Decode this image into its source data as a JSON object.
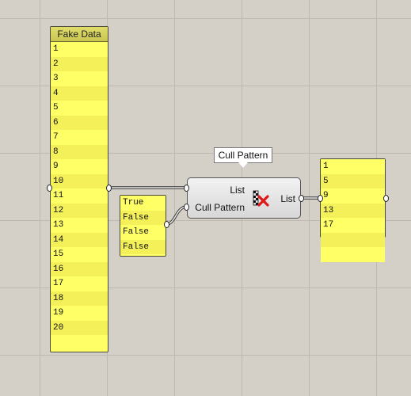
{
  "tooltip": {
    "text": "Cull Pattern"
  },
  "data_panel": {
    "title": "Fake Data",
    "rows": [
      "1",
      "2",
      "3",
      "4",
      "5",
      "6",
      "7",
      "8",
      "9",
      "10",
      "11",
      "12",
      "13",
      "14",
      "15",
      "16",
      "17",
      "18",
      "19",
      "20",
      ""
    ]
  },
  "pattern_panel": {
    "rows": [
      "True",
      "False",
      "False",
      "False"
    ]
  },
  "cull_component": {
    "input_list_label": "List",
    "input_pattern_label": "Cull Pattern",
    "output_label": "List",
    "icon": "cull-pattern-icon"
  },
  "result_panel": {
    "rows": [
      "1",
      "5",
      "9",
      "13",
      "17",
      "",
      ""
    ]
  },
  "colors": {
    "panel_fill": "#ffff66",
    "panel_stripe": "#f4f05a",
    "canvas": "#d4d0c8",
    "icon_cross": "#e01818"
  }
}
